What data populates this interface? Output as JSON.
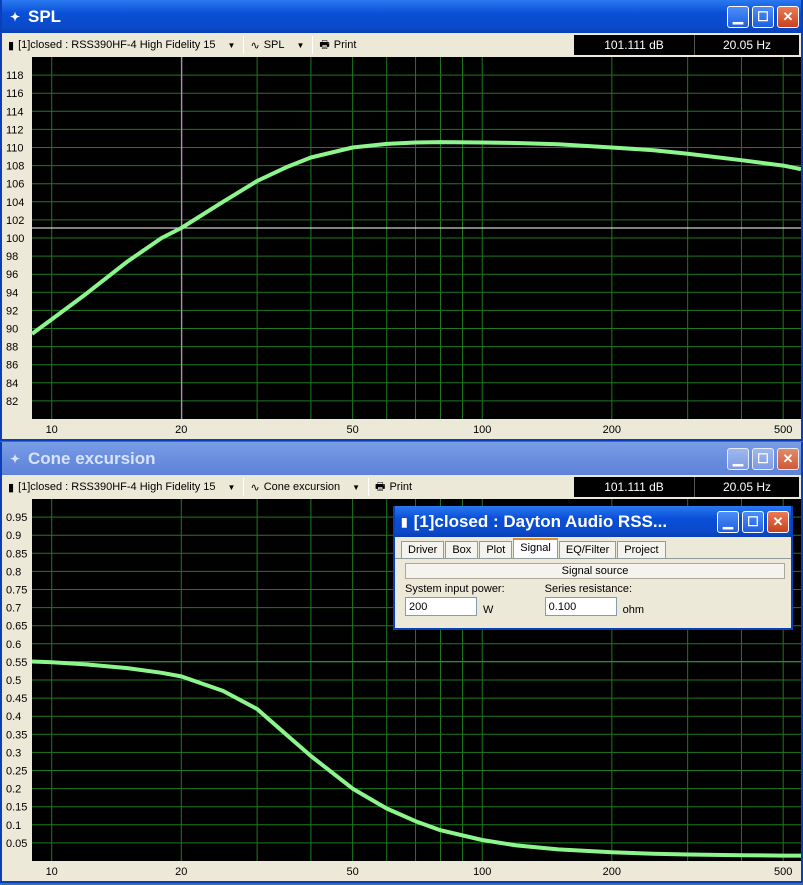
{
  "colors": {
    "plot_bg": "#000000",
    "grid": "#1e7a1e",
    "curve": "#8cf58c",
    "spl_cursor_h": "#ffffff",
    "spl_cursor_v": "#f08cf0",
    "cone_cursor_h": "#e03030"
  },
  "spl_window": {
    "title": "SPL",
    "toolbar": {
      "driver": "[1]closed : RSS390HF-4 High Fidelity 15",
      "plot": "SPL",
      "print": "Print"
    },
    "readout_db": "101.111 dB",
    "readout_hz": "20.05 Hz"
  },
  "cone_window": {
    "title": "Cone excursion",
    "toolbar": {
      "driver": "[1]closed : RSS390HF-4 High Fidelity 15",
      "plot": "Cone excursion",
      "print": "Print"
    },
    "readout_db": "101.111 dB",
    "readout_hz": "20.05 Hz"
  },
  "dialog": {
    "title": "[1]closed : Dayton Audio RSS...",
    "tabs": [
      "Driver",
      "Box",
      "Plot",
      "Signal",
      "EQ/Filter",
      "Project"
    ],
    "active_tab": "Signal",
    "group_label": "Signal source",
    "power_label": "System input power:",
    "power_value": "200",
    "power_unit": "W",
    "resistance_label": "Series resistance:",
    "resistance_value": "0.100",
    "resistance_unit": "ohm"
  },
  "chart_data": [
    {
      "type": "line",
      "title": "SPL",
      "x_scale": "log",
      "xlim": [
        9,
        550
      ],
      "ylim": [
        80,
        120
      ],
      "x_ticks": [
        10,
        20,
        50,
        100,
        200,
        500
      ],
      "y_ticks": [
        82,
        84,
        86,
        88,
        90,
        92,
        94,
        96,
        98,
        100,
        102,
        104,
        106,
        108,
        110,
        112,
        114,
        116,
        118
      ],
      "series": [
        {
          "x": [
            9,
            10,
            12,
            15,
            18,
            20,
            25,
            30,
            35,
            40,
            50,
            60,
            70,
            80,
            100,
            120,
            150,
            200,
            250,
            300,
            400,
            500,
            550
          ],
          "y": [
            89.4,
            91.0,
            93.8,
            97.4,
            100.0,
            101.1,
            104.0,
            106.3,
            107.8,
            108.9,
            110.0,
            110.4,
            110.55,
            110.6,
            110.55,
            110.5,
            110.35,
            110.0,
            109.7,
            109.3,
            108.6,
            108.0,
            107.6
          ]
        }
      ],
      "cursor": {
        "x": 20.05,
        "y": 101.111
      }
    },
    {
      "type": "line",
      "title": "Cone excursion",
      "x_scale": "log",
      "xlim": [
        9,
        550
      ],
      "ylim": [
        0,
        1.0
      ],
      "x_ticks": [
        10,
        20,
        50,
        100,
        200,
        500
      ],
      "y_ticks": [
        0.05,
        0.1,
        0.15,
        0.2,
        0.25,
        0.3,
        0.35,
        0.4,
        0.45,
        0.5,
        0.55,
        0.6,
        0.65,
        0.7,
        0.75,
        0.8,
        0.85,
        0.9,
        0.95
      ],
      "series": [
        {
          "x": [
            9,
            10,
            12,
            15,
            18,
            20,
            25,
            30,
            35,
            40,
            50,
            60,
            70,
            80,
            100,
            120,
            150,
            200,
            250,
            300,
            400,
            500,
            550
          ],
          "y": [
            0.551,
            0.549,
            0.543,
            0.533,
            0.52,
            0.51,
            0.47,
            0.42,
            0.35,
            0.29,
            0.2,
            0.145,
            0.11,
            0.085,
            0.058,
            0.043,
            0.032,
            0.024,
            0.02,
            0.018,
            0.016,
            0.015,
            0.015
          ]
        }
      ],
      "cursor": {
        "y": 0.551
      }
    }
  ]
}
